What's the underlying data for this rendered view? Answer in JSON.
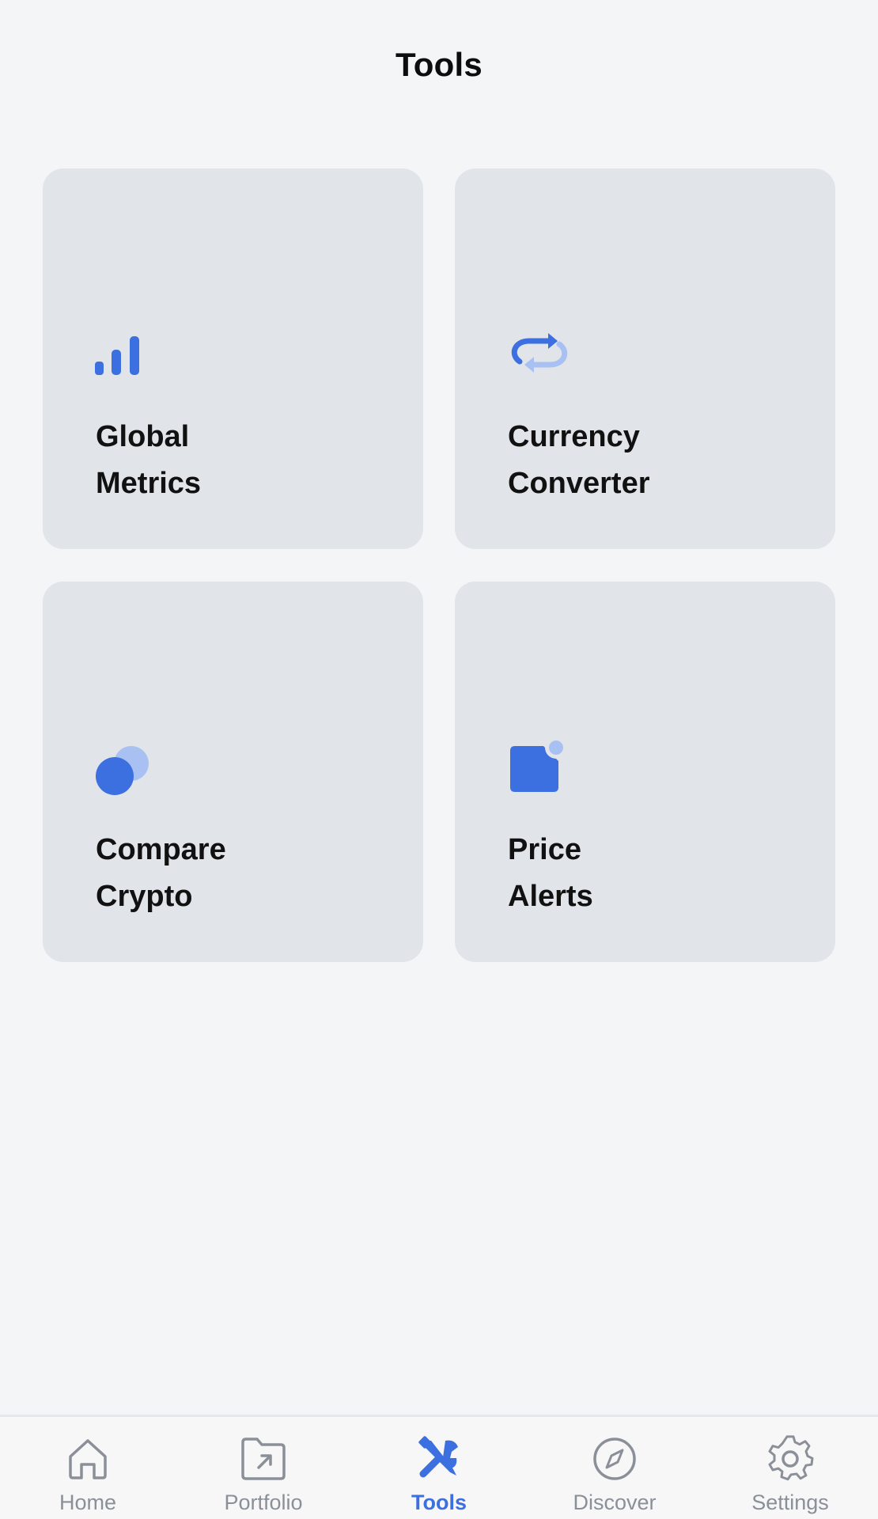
{
  "header": {
    "title": "Tools"
  },
  "tools": [
    {
      "line1": "Global",
      "line2": "Metrics",
      "icon": "bar-chart-icon"
    },
    {
      "line1": "Currency",
      "line2": "Converter",
      "icon": "swap-arrows-icon"
    },
    {
      "line1": "Compare",
      "line2": "Crypto",
      "icon": "overlapping-circles-icon"
    },
    {
      "line1": "Price",
      "line2": "Alerts",
      "icon": "alert-badge-icon"
    }
  ],
  "tabbar": {
    "active": "Tools",
    "items": [
      {
        "label": "Home",
        "icon": "home-icon"
      },
      {
        "label": "Portfolio",
        "icon": "folder-arrow-icon"
      },
      {
        "label": "Tools",
        "icon": "wrench-tools-icon"
      },
      {
        "label": "Discover",
        "icon": "compass-icon"
      },
      {
        "label": "Settings",
        "icon": "gear-icon"
      }
    ]
  },
  "colors": {
    "accent": "#3c6fe0",
    "accent_light": "#a9c1f2",
    "tile_background": "#e1e4e9",
    "page_background": "#f4f5f7",
    "inactive_tab": "#8a8f98"
  }
}
